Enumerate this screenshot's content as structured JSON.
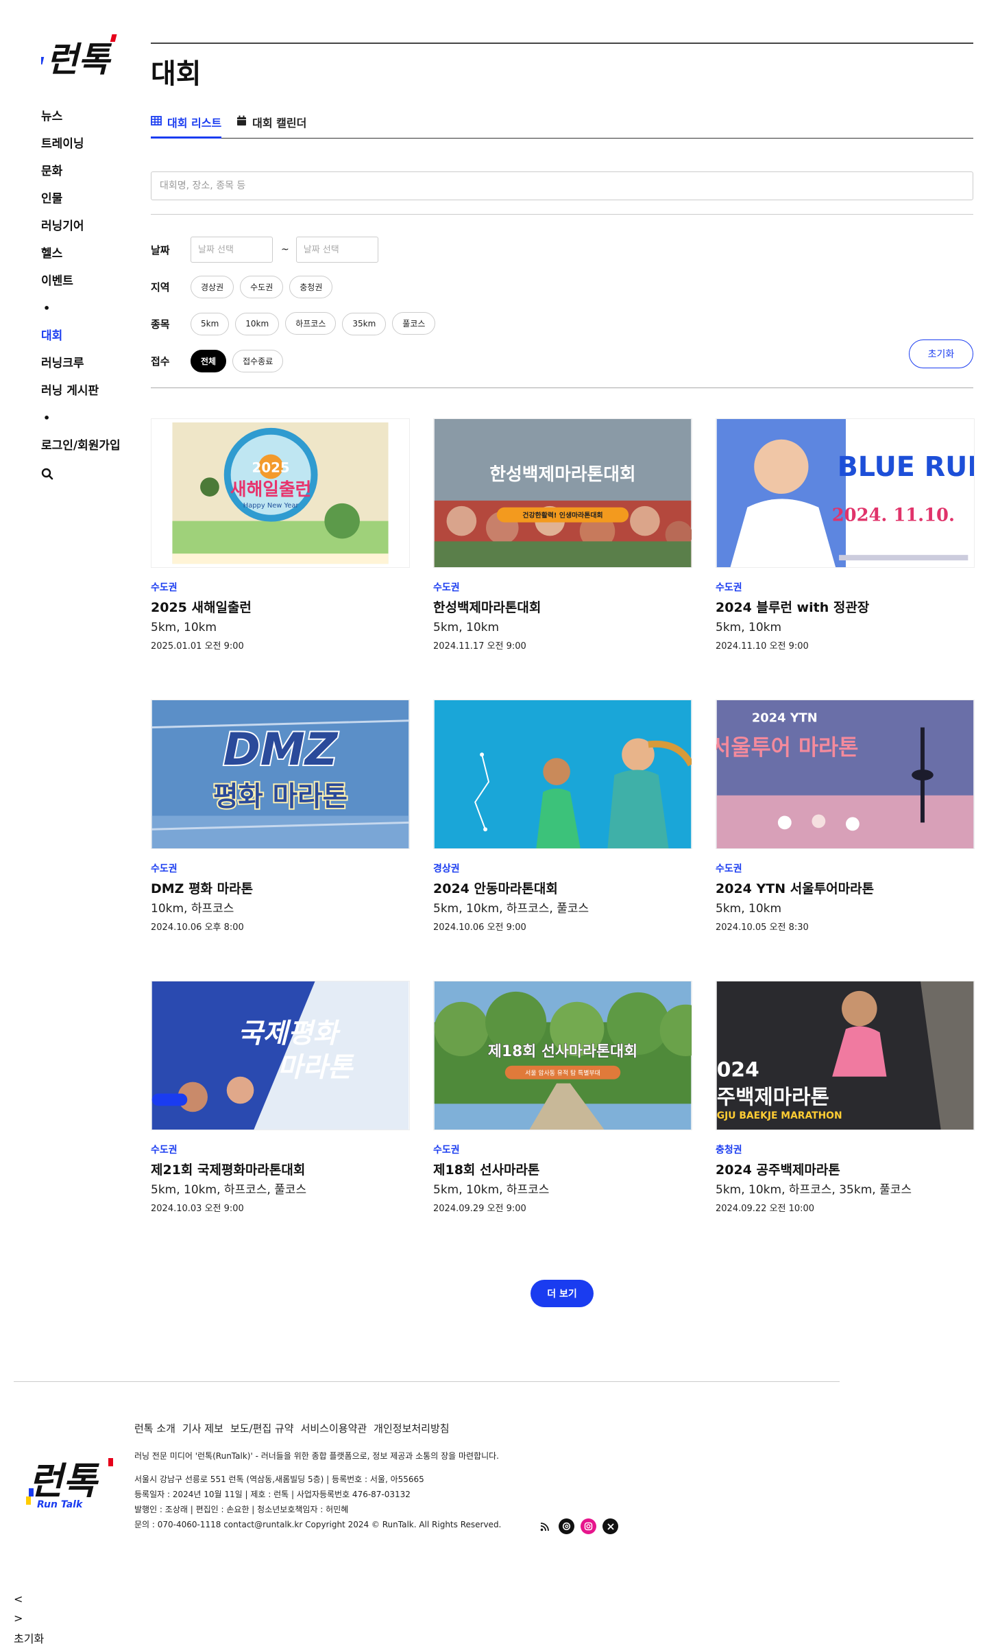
{
  "brand": {
    "logo_text": "런톡",
    "footer_logo_sub": "Run Talk",
    "accent": "#1a3cf0"
  },
  "sidebar": {
    "items": [
      {
        "label": "뉴스",
        "name": "sidebar-item-news"
      },
      {
        "label": "트레이닝",
        "name": "sidebar-item-training"
      },
      {
        "label": "문화",
        "name": "sidebar-item-culture"
      },
      {
        "label": "인물",
        "name": "sidebar-item-people"
      },
      {
        "label": "러닝기어",
        "name": "sidebar-item-running-gear"
      },
      {
        "label": "헬스",
        "name": "sidebar-item-health"
      },
      {
        "label": "이벤트",
        "name": "sidebar-item-event"
      },
      {
        "label": "•",
        "name": "sidebar-dot"
      },
      {
        "label": "대회",
        "name": "sidebar-item-races",
        "active": true
      },
      {
        "label": "러닝크루",
        "name": "sidebar-item-running-crew"
      },
      {
        "label": "러닝 게시판",
        "name": "sidebar-item-board"
      },
      {
        "label": "•",
        "name": "sidebar-dot"
      },
      {
        "label": "로그인/회원가입",
        "name": "sidebar-item-login"
      }
    ],
    "search_icon": "search-icon"
  },
  "main": {
    "title": "대회",
    "tabs": [
      {
        "label": "대회 리스트",
        "icon": "table-icon",
        "active": true
      },
      {
        "label": "대회 캘린더",
        "icon": "calendar-icon",
        "active": false
      }
    ],
    "search": {
      "placeholder": "대회명, 장소, 종목 등"
    }
  },
  "filters": {
    "date": {
      "label": "날짜",
      "start_placeholder": "날짜 선택",
      "separator": "~",
      "end_placeholder": "날짜 선택"
    },
    "region": {
      "label": "지역",
      "options": [
        "경상권",
        "수도권",
        "충청권"
      ]
    },
    "event": {
      "label": "종목",
      "options": [
        "5km",
        "10km",
        "하프코스",
        "35km",
        "풀코스"
      ]
    },
    "registration": {
      "label": "접수",
      "options": [
        "전체",
        "접수종료"
      ],
      "selected": "전체"
    },
    "reset_label": "초기화"
  },
  "races": [
    {
      "region": "수도권",
      "title": "2025 새해일출런",
      "events": "5km, 10km",
      "date": "2025.01.01 오전 9:00"
    },
    {
      "region": "수도권",
      "title": "한성백제마라톤대회",
      "events": "5km, 10km",
      "date": "2024.11.17 오전 9:00"
    },
    {
      "region": "수도권",
      "title": "2024 블루런 with 정관장",
      "events": "5km, 10km",
      "date": "2024.11.10 오전 9:00"
    },
    {
      "region": "수도권",
      "title": "DMZ 평화 마라톤",
      "events": "10km, 하프코스",
      "date": "2024.10.06 오후 8:00"
    },
    {
      "region": "경상권",
      "title": "2024 안동마라톤대회",
      "events": "5km, 10km, 하프코스, 풀코스",
      "date": "2024.10.06 오전 9:00"
    },
    {
      "region": "수도권",
      "title": "2024 YTN 서울투어마라톤",
      "events": "5km, 10km",
      "date": "2024.10.05 오전 8:30"
    },
    {
      "region": "수도권",
      "title": "제21회 국제평화마라톤대회",
      "events": "5km, 10km, 하프코스, 풀코스",
      "date": "2024.10.03 오전 9:00"
    },
    {
      "region": "수도권",
      "title": "제18회 선사마라톤",
      "events": "5km, 10km, 하프코스",
      "date": "2024.09.29 오전 9:00"
    },
    {
      "region": "충청권",
      "title": "2024 공주백제마라톤",
      "events": "5km, 10km, 하프코스, 35km, 풀코스",
      "date": "2024.09.22 오전 10:00"
    }
  ],
  "poster_texts": {
    "p1_year": "2025",
    "p1_title": "새해일출런",
    "p1_sub": "Happy New Year",
    "p2_title": "한성백제마라톤대회",
    "p2_sub": "건강한활력! 인생마라톤대회",
    "p3_title": "BLUE RUN",
    "p3_date": "2024. 11.10.",
    "p4_l1": "DMZ",
    "p4_l2": "평화 마라톤",
    "p6_top": "2024 YTN",
    "p6_title": "서울투어 마라톤",
    "p7_l1": "국제평화",
    "p7_l2": "마라톤",
    "p8_title": "제18회 선사마라톤대회",
    "p8_sub": "서울 암사동 유적 탐 특별부대",
    "p9_l1": "024",
    "p9_l2": "주백제마라톤",
    "p9_l3": "GJU BAEKJE MARATHON"
  },
  "more_label": "더 보기",
  "footer": {
    "links": [
      "런톡 소개",
      "기사 제보",
      "보도/편집 규약",
      "서비스이용약관",
      "개인정보처리방침"
    ],
    "description": "러닝 전문 미디어 '런톡(RunTalk)' - 러너들을 위한 종합 플랫폼으로, 정보 제공과 소통의 장을 마련합니다.",
    "info": [
      "서울시 강남구 선릉로 551 런톡 (역삼동,새롬빌딩 5층) | 등록번호 : 서울, 아55665",
      "등록일자 : 2024년 10월 11일 | 제호 : 런톡 | 사업자등록번호 476-87-03132",
      "발행인 : 조상래 | 편집인 : 손요한 | 청소년보호책임자 : 허민혜",
      "문의 : 070-4060-1118 contact@runtalk.kr Copyright 2024 © RunTalk. All Rights Reserved."
    ],
    "social": [
      {
        "name": "rss-icon",
        "color": "#ffffff"
      },
      {
        "name": "threads-icon",
        "color": "#111111"
      },
      {
        "name": "instagram-icon",
        "color": "#e6158c"
      },
      {
        "name": "x-icon",
        "color": "#111111"
      }
    ]
  },
  "bottom": {
    "prev": "<",
    "next": ">",
    "reset": "초기화"
  }
}
